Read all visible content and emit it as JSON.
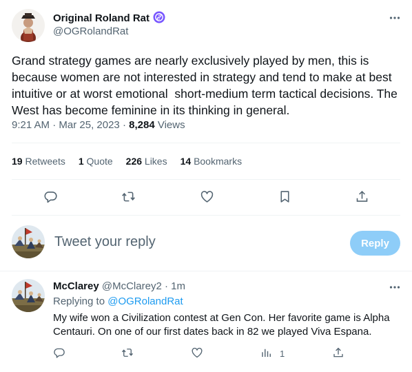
{
  "tweet": {
    "author_name": "Original Roland Rat",
    "author_handle": "@OGRolandRat",
    "text": "Grand strategy games are nearly exclusively played by men, this is because women are not interested in strategy and tend to make at best intuitive or at worst emotional  short-medium term tactical decisions. The West has become feminine in its thinking in general.",
    "time": "9:21 AM",
    "date": "Mar 25, 2023",
    "views_count": "8,284",
    "views_label": "Views",
    "stats": {
      "retweets_count": "19",
      "retweets_label": "Retweets",
      "quotes_count": "1",
      "quotes_label": "Quote",
      "likes_count": "226",
      "likes_label": "Likes",
      "bookmarks_count": "14",
      "bookmarks_label": "Bookmarks"
    }
  },
  "reply_composer": {
    "placeholder": "Tweet your reply",
    "button_label": "Reply"
  },
  "comment": {
    "author_name": "McClarey",
    "author_handle": "@McClarey2",
    "separator": "·",
    "time_ago": "1m",
    "replying_prefix": "Replying to",
    "replying_to": "@OGRolandRat",
    "text": "My wife won a Civilization contest at Gen Con.  Her favorite game is Alpha Centauri.  On one of our first dates back in 82 we played Viva Espana.",
    "views_count": "1"
  },
  "colors": {
    "accent": "#1d9bf0",
    "reply_button_disabled": "#8ecdf8",
    "secondary_text": "#536471",
    "primary_text": "#0f1419",
    "divider": "#eff3f4",
    "verified_badge": "#7856ff"
  },
  "icons": {
    "verified": "verified-badge-icon",
    "more": "more-options-icon",
    "reply": "reply-bubble-icon",
    "retweet": "retweet-icon",
    "like": "heart-icon",
    "bookmark": "bookmark-icon",
    "share": "share-icon",
    "views": "analytics-icon"
  }
}
